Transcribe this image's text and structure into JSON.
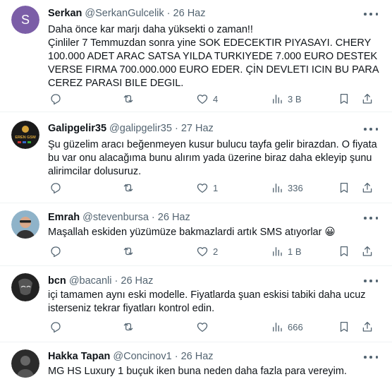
{
  "tweets": [
    {
      "name": "Serkan",
      "handle": "@SerkanGulcelik",
      "date": "26 Haz",
      "avatar_letter": "S",
      "avatar_color": "#7b5ea7",
      "text": "Daha önce kar marjı daha yüksekti o zaman!!\nÇinliler 7 Temmuzdan sonra yine SOK EDECEKTIR PIYASAYI. CHERY 100.000 ADET ARAC SATSA YILDA TURKIYEDE 7.000 EURO DESTEK VERSE FIRMA 700.000.000 EURO EDER. ÇİN DEVLETI ICIN BU PARA CEREZ PARASI BILE DEGIL.",
      "replies": "",
      "retweets": "",
      "likes": "4",
      "views": "3 B"
    },
    {
      "name": "Galipgelir35",
      "handle": "@galipgelir35",
      "date": "27 Haz",
      "avatar_text": "EREN GSM",
      "avatar_color": "#1a1a1a",
      "text": "Şu güzelim aracı beğenmeyen kusur bulucu tayfa gelir birazdan. O fiyata bu var onu alacağıma bunu alırım yada üzerine biraz daha ekleyip şunu alirimcilar dolusuruz.",
      "replies": "",
      "retweets": "",
      "likes": "1",
      "views": "336"
    },
    {
      "name": "Emrah",
      "handle": "@stevenbursa",
      "date": "26 Haz",
      "avatar_color": "#8fb3c9",
      "text": "Maşallah eskiden yüzümüze bakmazlardi artık SMS atıyorlar 😀",
      "replies": "",
      "retweets": "",
      "likes": "2",
      "views": "1 B"
    },
    {
      "name": "bcn",
      "handle": "@bacanli",
      "date": "26 Haz",
      "avatar_color": "#222222",
      "text": "içi tamamen aynı eski modelle. Fiyatlarda şuan eskisi tabiki daha ucuz isterseniz tekrar fiyatları kontrol edin.",
      "replies": "",
      "retweets": "",
      "likes": "",
      "views": "666"
    },
    {
      "name": "Hakka Tapan",
      "handle": "@Concinov1",
      "date": "26 Haz",
      "avatar_color": "#2b2b2b",
      "text": "MG HS Luxury 1 buçuk iken buna neden daha fazla para vereyim."
    }
  ],
  "separator": "·",
  "colors": {
    "text": "#0f1419",
    "muted": "#536471",
    "border": "#eff3f4"
  },
  "icons": [
    "reply-icon",
    "retweet-icon",
    "like-icon",
    "views-icon",
    "bookmark-icon",
    "share-icon",
    "more-icon"
  ]
}
